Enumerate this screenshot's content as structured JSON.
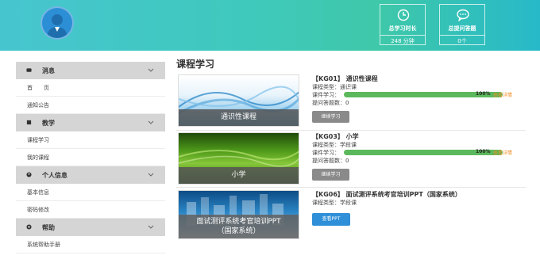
{
  "header": {
    "stats": [
      {
        "label": "总学习时长",
        "value": "248 分钟",
        "icon": "clock-icon"
      },
      {
        "label": "总提问答题",
        "value": "0个",
        "icon": "chat-icon"
      }
    ]
  },
  "sidebar": {
    "sections": [
      {
        "label": "消息",
        "icon": "message-icon",
        "items": [
          "首　　页",
          "通知公告"
        ]
      },
      {
        "label": "教学",
        "icon": "book-icon",
        "items": [
          "课程学习",
          "我的课程"
        ]
      },
      {
        "label": "个人信息",
        "icon": "user-icon",
        "items": [
          "基本信息",
          "密码修改"
        ]
      },
      {
        "label": "帮助",
        "icon": "help-icon",
        "items": [
          "系统帮助手册"
        ]
      }
    ]
  },
  "main": {
    "title": "课程学习",
    "courses": [
      {
        "title": "【KG01】 通识性课程",
        "type": "课程类型：通识课",
        "progress_label": "课件学习：",
        "progress": 100,
        "progress_text": "100%",
        "detail_link": "查看详情",
        "answers": "提问答题数：0",
        "button": "继续学习",
        "thumb_caption": "通识性课程",
        "thumb_color": "#4aa8d8"
      },
      {
        "title": "【KG03】 小学",
        "type": "课程类型：学段课",
        "progress_label": "课件学习：",
        "progress": 100,
        "progress_text": "100%",
        "detail_link": "查看详情",
        "answers": "提问答题数：0",
        "button": "继续学习",
        "thumb_caption": "小学",
        "thumb_color": "#4f9a1a"
      },
      {
        "title": "【KG06】 面试测评系统考官培训PPT（国家系统）",
        "type": "课程类型：学段课",
        "button": "查看PPT",
        "thumb_caption": "面试测评系统考官培训PPT\n（国家系统）",
        "thumb_color": "#2b86c6"
      }
    ]
  },
  "colors": {
    "header_start": "#47c5cf",
    "progress": "#5cb85c",
    "link": "#f58a1f",
    "primary_button": "#2f8fd8"
  }
}
